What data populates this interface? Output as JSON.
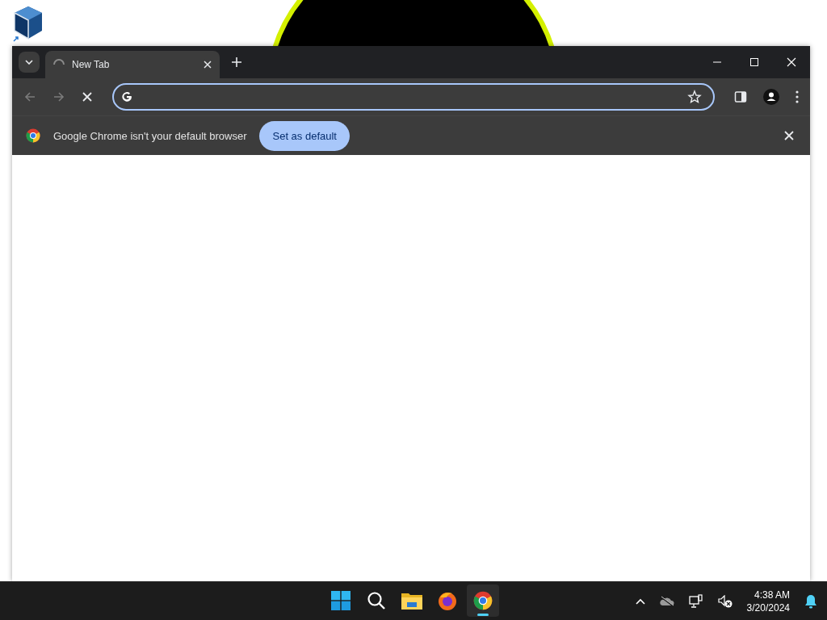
{
  "browser": {
    "tabs": [
      {
        "title": "New Tab",
        "selected": true,
        "loading": true
      }
    ],
    "infobar": {
      "message": "Google Chrome isn't your default browser",
      "button": "Set as default"
    }
  },
  "taskbar": {
    "apps": [
      {
        "kind": "start",
        "active": false
      },
      {
        "kind": "search",
        "active": false
      },
      {
        "kind": "files",
        "active": false
      },
      {
        "kind": "firefox",
        "active": false
      },
      {
        "kind": "chrome",
        "active": true
      }
    ],
    "time": "4:38 AM",
    "date": "3/20/2024"
  }
}
